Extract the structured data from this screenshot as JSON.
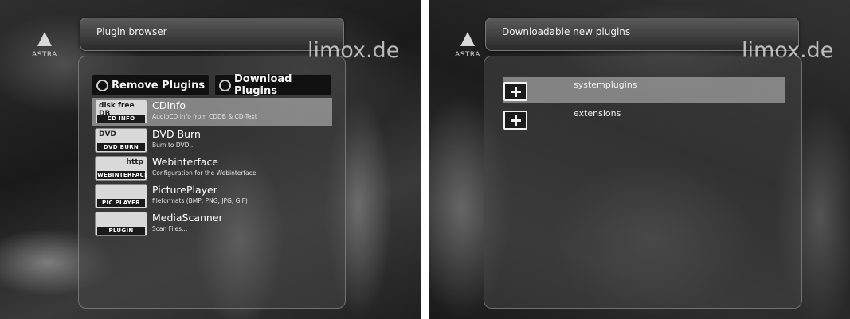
{
  "left_screen": {
    "logo_text": "ASTRA",
    "title": "Plugin browser",
    "watermark": "limox.de",
    "tabs": [
      {
        "label": "Remove Plugins"
      },
      {
        "label": "Download Plugins"
      }
    ],
    "plugins": [
      {
        "icon_caption": "CD INFO",
        "icon_art": "disk free DB",
        "name": "CDInfo",
        "description": "AudioCD info from CDDB & CD-Text",
        "selected": true
      },
      {
        "icon_caption": "DVD BURN",
        "icon_art": "DVD",
        "name": "DVD Burn",
        "description": "Burn to DVD...",
        "selected": false
      },
      {
        "icon_caption": "WEBINTERFACE",
        "icon_art": "http",
        "name": "Webinterface",
        "description": "Configuration for the Webinterface",
        "selected": false
      },
      {
        "icon_caption": "PIC PLAYER",
        "icon_art": "",
        "name": "PicturePlayer",
        "description": "fileformats (BMP, PNG, JPG, GIF)",
        "selected": false
      },
      {
        "icon_caption": "PLUGIN",
        "icon_art": "",
        "name": "MediaScanner",
        "description": "Scan Files...",
        "selected": false
      }
    ]
  },
  "right_screen": {
    "logo_text": "ASTRA",
    "title": "Downloadable new plugins",
    "watermark": "limox.de",
    "categories": [
      {
        "label": "systemplugins",
        "selected": true
      },
      {
        "label": "extensions",
        "selected": false
      }
    ]
  }
}
